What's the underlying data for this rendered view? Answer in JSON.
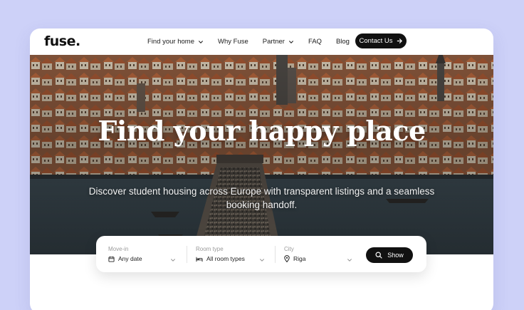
{
  "brand": {
    "logo": "fuse."
  },
  "nav": {
    "items": [
      {
        "label": "Find your home",
        "dropdown": true
      },
      {
        "label": "Why Fuse",
        "dropdown": false
      },
      {
        "label": "Partner",
        "dropdown": true
      },
      {
        "label": "FAQ",
        "dropdown": false
      },
      {
        "label": "Blog",
        "dropdown": false
      }
    ],
    "cta": {
      "label": "Contact Us",
      "icon": "arrow-right-icon"
    }
  },
  "hero": {
    "title": "Find your happy place",
    "subtitle": "Discover student housing across Europe with transparent listings and a seamless booking handoff."
  },
  "search": {
    "move_in": {
      "label": "Move-in",
      "value": "Any date",
      "icon": "calendar-icon"
    },
    "room_type": {
      "label": "Room type",
      "value": "All room types",
      "icon": "bed-icon"
    },
    "city": {
      "label": "City",
      "value": "Riga",
      "icon": "map-pin-icon"
    },
    "show_button": {
      "label": "Show",
      "icon": "search-icon"
    }
  },
  "colors": {
    "page_background": "#cdd1f8",
    "card_background": "#ffffff",
    "button_background": "#111111",
    "button_text": "#ffffff"
  }
}
